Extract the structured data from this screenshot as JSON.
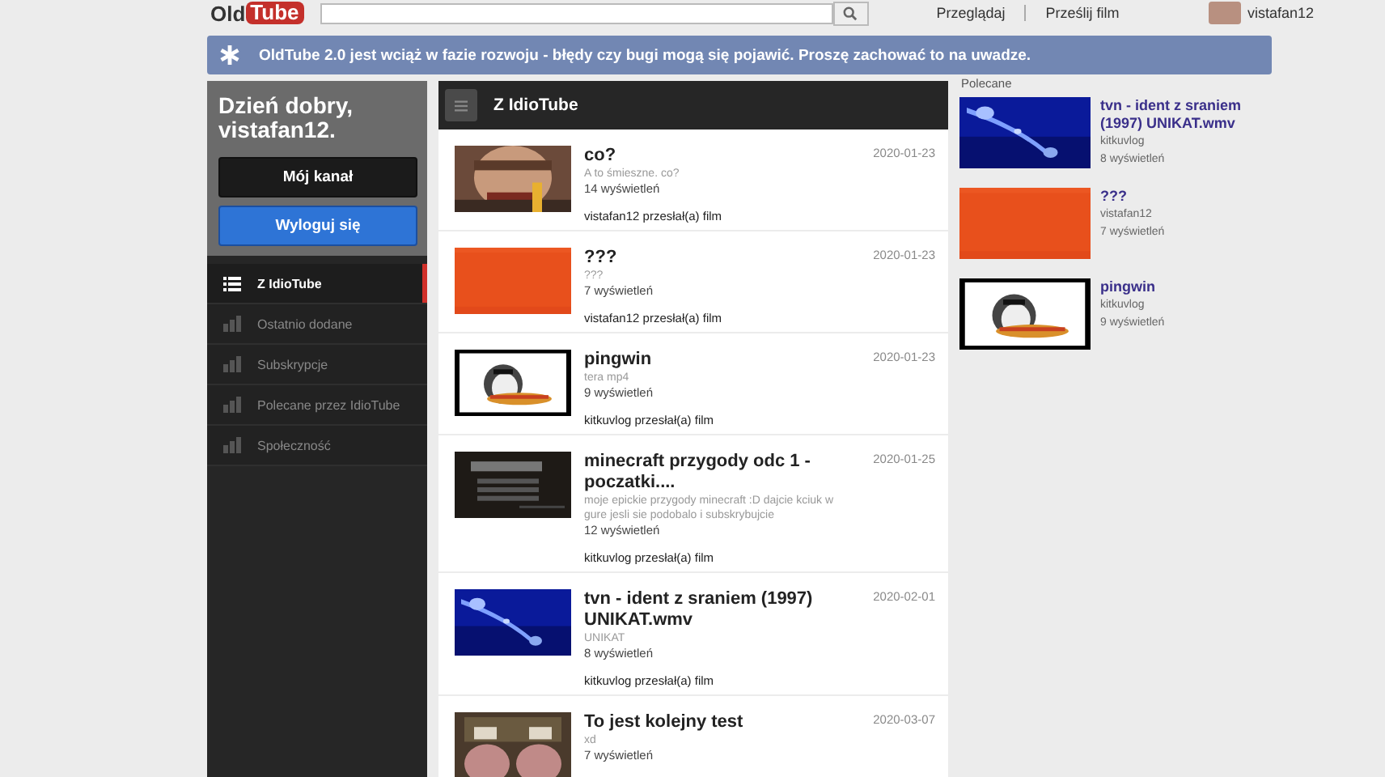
{
  "header": {
    "logo": {
      "left": "Old",
      "right": "Tube"
    },
    "nav": [
      "Przeglądaj",
      "Prześlij film"
    ],
    "user": "vistafan12"
  },
  "banner": {
    "text": "OldTube 2.0 jest wciąż w fazie rozwoju - błędy czy bugi mogą się pojawić. Proszę zachować to na uwadze."
  },
  "sidebar": {
    "greeting": "Dzień dobry, vistafan12.",
    "buttons": [
      {
        "label": "Mój kanał",
        "kind": "dark"
      },
      {
        "label": "Wyloguj się",
        "kind": "primary"
      }
    ],
    "items": [
      {
        "label": "Z IdioTube",
        "selected": true
      },
      {
        "label": "Ostatnio dodane",
        "selected": false
      },
      {
        "label": "Subskrypcje",
        "selected": false
      },
      {
        "label": "Polecane przez IdioTube",
        "selected": false
      },
      {
        "label": "Społeczność",
        "selected": false
      }
    ]
  },
  "feed": {
    "title": "Z IdioTube",
    "items": [
      {
        "title": "co?",
        "description": "A to śmieszne. co?",
        "views": "14 wyświetleń",
        "uploader": "vistafan12 przesłał(a) film",
        "date": "2020-01-23"
      },
      {
        "title": "???",
        "description": "???",
        "views": "7 wyświetleń",
        "uploader": "vistafan12 przesłał(a) film",
        "date": "2020-01-23"
      },
      {
        "title": "pingwin",
        "description": "tera mp4",
        "views": "9 wyświetleń",
        "uploader": "kitkuvlog przesłał(a) film",
        "date": "2020-01-23"
      },
      {
        "title": "minecraft przygody odc 1 - poczatki....",
        "description": "moje epickie przygody minecraft :D dajcie kciuk w gure jesli sie podobalo i subskrybujcie",
        "views": "12 wyświetleń",
        "uploader": "kitkuvlog przesłał(a) film",
        "date": "2020-01-25"
      },
      {
        "title": "tvn - ident z sraniem (1997) UNIKAT.wmv",
        "description": "UNIKAT",
        "views": "8 wyświetleń",
        "uploader": "kitkuvlog przesłał(a) film",
        "date": "2020-02-01"
      },
      {
        "title": "To jest kolejny test",
        "description": "xd",
        "views": "7 wyświetleń",
        "date": "2020-03-07"
      }
    ]
  },
  "recommended": {
    "title": "Polecane",
    "items": [
      {
        "title": "tvn - ident z sraniem (1997) UNIKAT.wmv",
        "channel": "kitkuvlog",
        "views": "8 wyświetleń"
      },
      {
        "title": "???",
        "channel": "vistafan12",
        "views": "7 wyświetleń"
      },
      {
        "title": "pingwin",
        "channel": "kitkuvlog",
        "views": "9 wyświetleń"
      }
    ]
  }
}
